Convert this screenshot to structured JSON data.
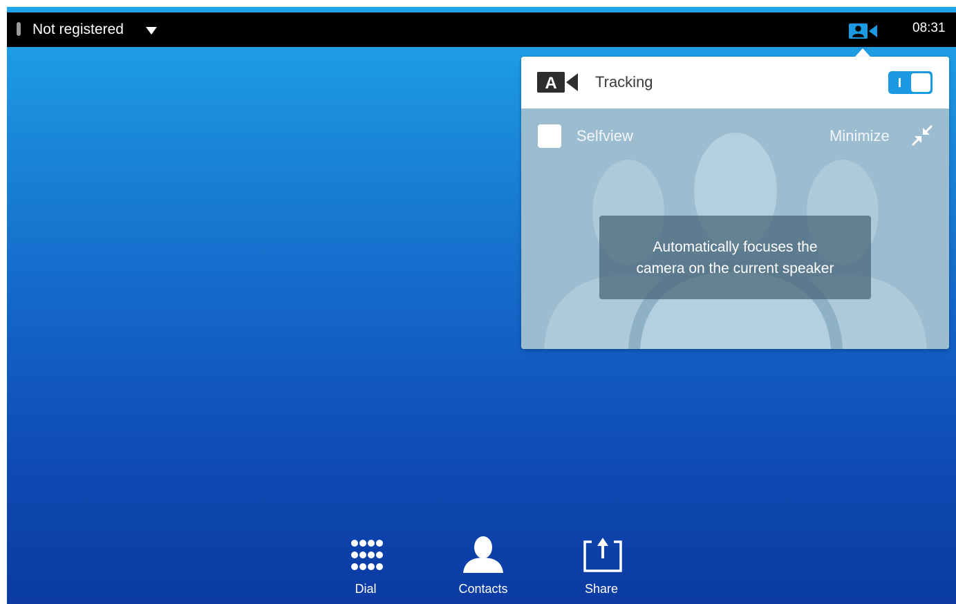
{
  "status_bar": {
    "registration_status": "Not registered",
    "clock": "08:31"
  },
  "camera_popover": {
    "tracking_label": "Tracking",
    "tracking_badge_letter": "A",
    "tracking_enabled": true,
    "selfview_label": "Selfview",
    "selfview_checked": false,
    "minimize_label": "Minimize",
    "tooltip_line1": "Automatically focuses the",
    "tooltip_line2": "camera on the current speaker"
  },
  "dock": {
    "dial_label": "Dial",
    "contacts_label": "Contacts",
    "share_label": "Share"
  },
  "colors": {
    "accent": "#1b9ae3",
    "topbar": "#000000",
    "background_top": "#1fa6e8",
    "background_bottom": "#0b3aa3"
  }
}
